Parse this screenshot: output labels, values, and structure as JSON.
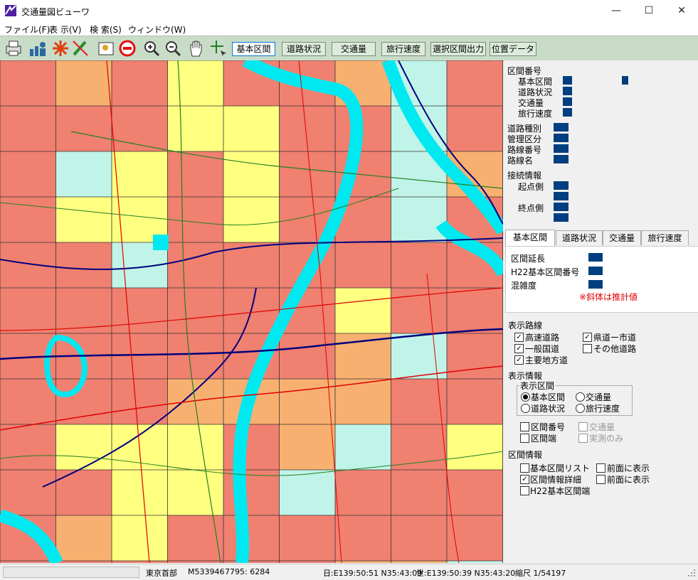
{
  "window": {
    "title": "交通量図ビューワ",
    "minimize": "—",
    "maximize": "☐",
    "close": "✕"
  },
  "menu": [
    "ファイル(F)",
    "表 示(V)",
    "検 索(S)",
    "ウィンドウ(W)"
  ],
  "toolbar": {
    "icons": [
      "printer-icon",
      "chart-user-icon",
      "asterisk-icon",
      "pencil-icon",
      "map-pin-icon",
      "no-entry-icon",
      "zoom-in-icon",
      "zoom-out-icon",
      "hand-pan-icon",
      "crosshair-select-icon"
    ],
    "buttons": [
      "基本区間",
      "道路状況",
      "交通量",
      "旅行速度",
      "選択区間出力",
      "位置データ"
    ],
    "active_button": "基本区間"
  },
  "side": {
    "section_no": "区間番号",
    "fields": [
      "基本区間",
      "道路状況",
      "交通量",
      "旅行速度"
    ],
    "road_fields": [
      "道路種別",
      "管理区分",
      "路線番号",
      "路線名"
    ],
    "connection": "接続情報",
    "start": "起点側",
    "end": "終点側"
  },
  "tabs": [
    "基本区間",
    "道路状況",
    "交通量",
    "旅行速度"
  ],
  "tabpanel": {
    "length": "区間延長",
    "h22_no": "H22基本区間番号",
    "congestion": "混雑度",
    "note": "※斜体は推計値"
  },
  "display_routes": {
    "title": "表示路線",
    "items": [
      {
        "label": "高速道路",
        "checked": true
      },
      {
        "label": "県道ー市道",
        "checked": true
      },
      {
        "label": "一般国道",
        "checked": true
      },
      {
        "label": "その他道路",
        "checked": false
      },
      {
        "label": "主要地方道",
        "checked": true
      }
    ]
  },
  "display_info": {
    "title": "表示情報",
    "group_title": "表示区間",
    "radios": [
      {
        "label": "基本区間",
        "selected": true
      },
      {
        "label": "交通量",
        "selected": false
      },
      {
        "label": "道路状況",
        "selected": false
      },
      {
        "label": "旅行速度",
        "selected": false
      }
    ],
    "checks": [
      {
        "label": "区間番号",
        "checked": false,
        "disabled": false
      },
      {
        "label": "交通量",
        "checked": false,
        "disabled": true
      },
      {
        "label": "区間端",
        "checked": false,
        "disabled": false
      },
      {
        "label": "実測のみ",
        "checked": false,
        "disabled": true
      }
    ]
  },
  "section_info": {
    "title": "区間情報",
    "items": [
      {
        "label": "基本区間リスト",
        "checked": false
      },
      {
        "label": "前面に表示",
        "checked": false
      },
      {
        "label": "区間情報詳細",
        "checked": true
      },
      {
        "label": "前面に表示",
        "checked": false
      },
      {
        "label": "H22基本区間端",
        "checked": false
      }
    ]
  },
  "status": {
    "area": "東京首部",
    "mesh": "M533946",
    "code": "7795: 6284",
    "japan_coord": "日:E139:50:51 N35:43:09",
    "world_coord": "世:E139:50:39 N35:43:20",
    "scale": "縮尺 1/54197"
  },
  "colors": {
    "red": "#f08070",
    "orange": "#f8b070",
    "yellow": "#ffff80",
    "cyan_light": "#c0f4e8",
    "river": "#00e8f0",
    "road_blue": "#00007f",
    "road_green": "#208020",
    "road_red": "#e00000"
  }
}
